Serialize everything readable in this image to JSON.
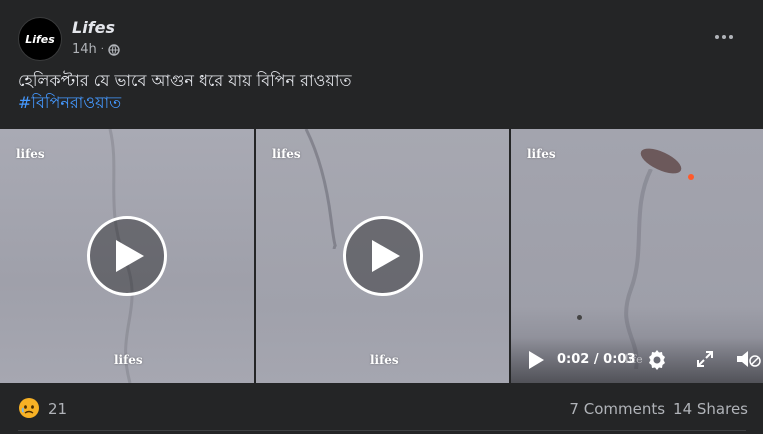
{
  "post": {
    "author": "Lifes",
    "avatar_text": "Lifes",
    "time": "14h",
    "caption": "হেলিকপ্টার যে ভাবে আগুন ধরে যায় বিপিন রাওয়াত",
    "hashtag": "#বিপিনরাওয়াত"
  },
  "media": {
    "watermark": "lifes",
    "tiles": [
      {
        "watermark_top": "lifes",
        "watermark_bottom": "lifes",
        "has_play": true
      },
      {
        "watermark_top": "lifes",
        "watermark_bottom": "lifes",
        "has_play": true
      },
      {
        "watermark_top": "lifes",
        "has_play": false
      }
    ],
    "player": {
      "current": "0:02",
      "separator": "/",
      "duration": "0:03",
      "faint_watermark": "life"
    }
  },
  "footer": {
    "reaction_icon": "sad-reaction-icon",
    "reaction_count": "21",
    "comments": "7 Comments",
    "shares": "14 Shares"
  },
  "colors": {
    "background": "#242526",
    "text": "#e4e6eb",
    "secondary": "#b0b3b8",
    "hashtag": "#4599ff"
  }
}
